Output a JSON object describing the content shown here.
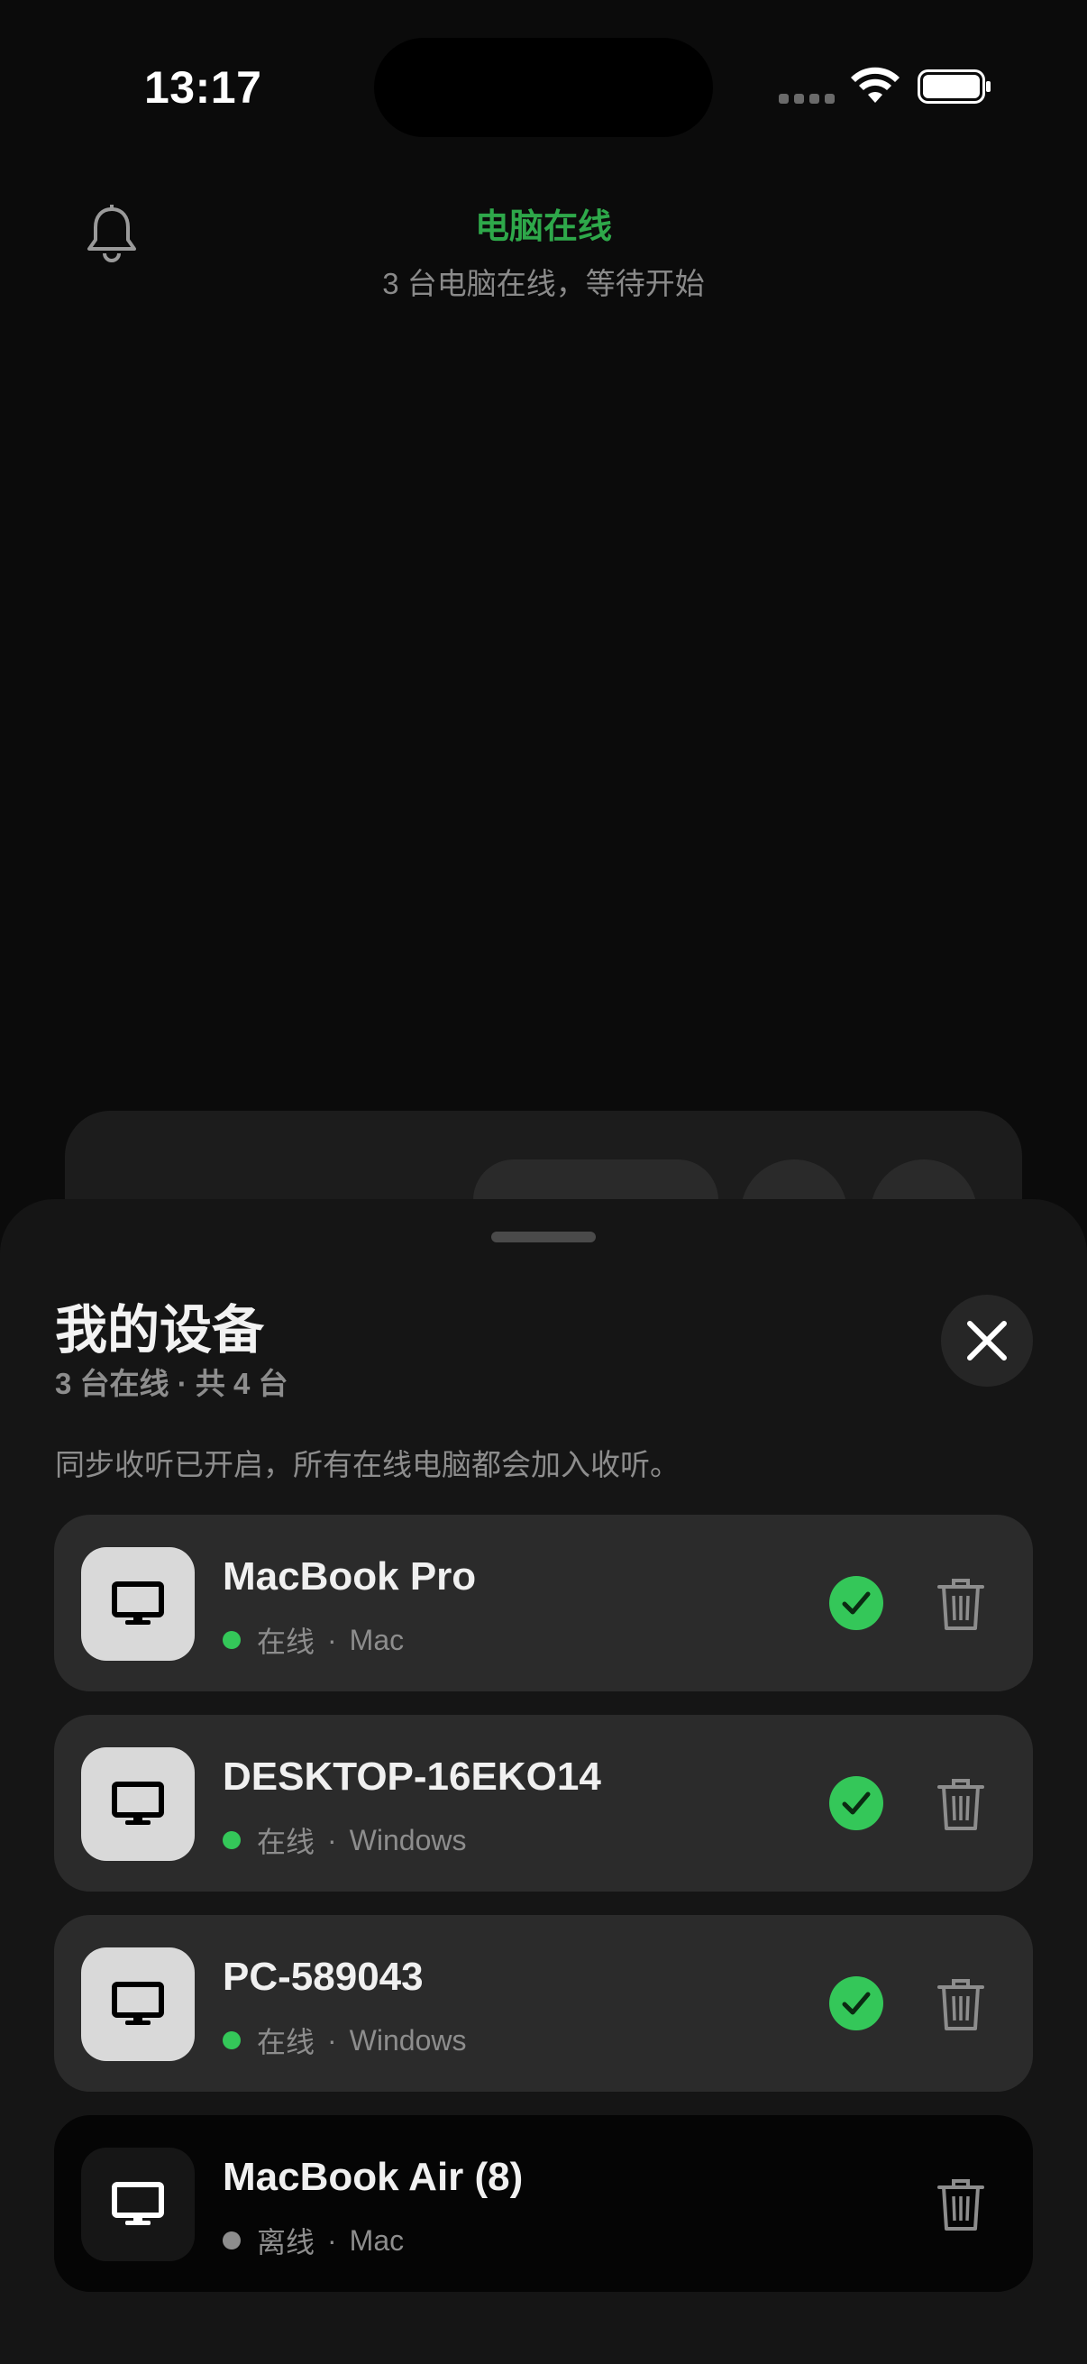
{
  "status_bar": {
    "time": "13:17"
  },
  "header": {
    "title": "电脑在线",
    "subtitle": "3 台电脑在线，等待开始",
    "accent_color": "#2ea84a"
  },
  "sheet": {
    "title": "我的设备",
    "summary": "3 台在线 · 共 4 台",
    "note": "同步收听已开启，所有在线电脑都会加入收听。",
    "devices": [
      {
        "name": "MacBook Pro",
        "status": "在线",
        "platform": "Mac",
        "selected": true,
        "online": true,
        "icon": "monitor-icon"
      },
      {
        "name": "DESKTOP-16EKO14",
        "status": "在线",
        "platform": "Windows",
        "selected": true,
        "online": true,
        "icon": "monitor-icon"
      },
      {
        "name": "PC-589043",
        "status": "在线",
        "platform": "Windows",
        "selected": true,
        "online": true,
        "icon": "monitor-icon"
      },
      {
        "name": "MacBook Air (8)",
        "status": "离线",
        "platform": "Mac",
        "selected": false,
        "online": false,
        "icon": "monitor-icon"
      }
    ],
    "separator": "·"
  },
  "colors": {
    "online": "#34c759",
    "offline": "#8d8d8d"
  }
}
